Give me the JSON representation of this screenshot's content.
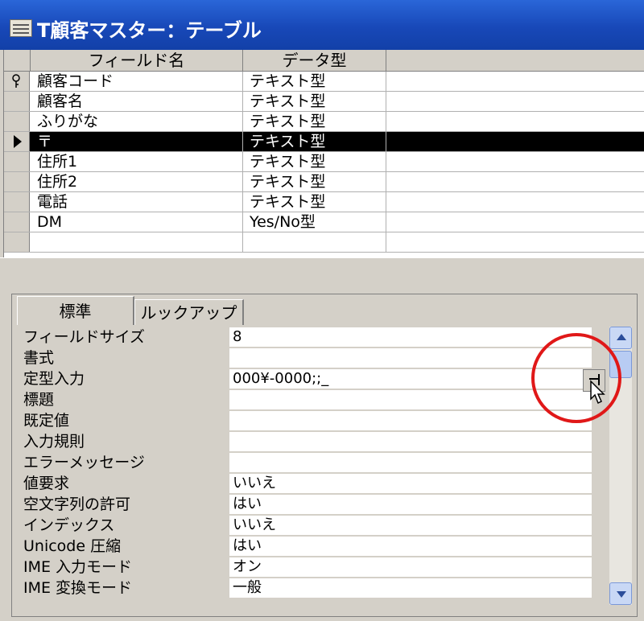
{
  "window": {
    "title": "T顧客マスター：テーブル",
    "icon": "table-icon"
  },
  "grid": {
    "columns": [
      "フィールド名",
      "データ型"
    ],
    "rows": [
      {
        "name": "顧客コード",
        "type": "テキスト型",
        "marker": "key-icon"
      },
      {
        "name": "顧客名",
        "type": "テキスト型"
      },
      {
        "name": "ふりがな",
        "type": "テキスト型"
      },
      {
        "name": "〒",
        "type": "テキスト型",
        "marker": "current-row-arrow-icon"
      },
      {
        "name": "住所1",
        "type": "テキスト型"
      },
      {
        "name": "住所2",
        "type": "テキスト型"
      },
      {
        "name": "電話",
        "type": "テキスト型"
      },
      {
        "name": "DM",
        "type": "Yes/No型"
      }
    ]
  },
  "tabs": {
    "general": "標準",
    "lookup": "ルックアップ"
  },
  "properties": [
    {
      "label": "フィールドサイズ",
      "value": "8"
    },
    {
      "label": "書式",
      "value": ""
    },
    {
      "label": "定型入力",
      "value": "000¥-0000;;_"
    },
    {
      "label": "標題",
      "value": ""
    },
    {
      "label": "既定値",
      "value": ""
    },
    {
      "label": "入力規則",
      "value": ""
    },
    {
      "label": "エラーメッセージ",
      "value": ""
    },
    {
      "label": "値要求",
      "value": "いいえ"
    },
    {
      "label": "空文字列の許可",
      "value": "はい"
    },
    {
      "label": "インデックス",
      "value": "いいえ"
    },
    {
      "label": "Unicode 圧縮",
      "value": "はい"
    },
    {
      "label": "IME 入力モード",
      "value": "オン"
    },
    {
      "label": "IME 変換モード",
      "value": "一般"
    }
  ],
  "colors": {
    "title_bar": "#1848b8",
    "highlight_circle": "#e01818",
    "selected_row": "#000000"
  },
  "icons": {
    "builder_button": "builder-icon",
    "cursor": "mouse-pointer-icon"
  }
}
